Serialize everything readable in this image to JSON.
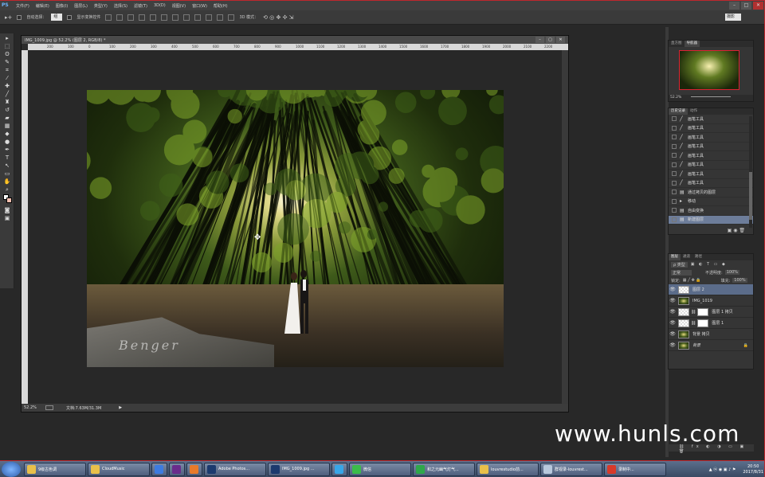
{
  "app": {
    "logo": "PS"
  },
  "menu": [
    "文件(F)",
    "编辑(E)",
    "图像(I)",
    "图层(L)",
    "类型(Y)",
    "选择(S)",
    "滤镜(T)",
    "3D(D)",
    "视图(V)",
    "窗口(W)",
    "帮助(H)"
  ],
  "options": {
    "auto_select_label": "自动选择：",
    "auto_select_value": "组",
    "transform_label": "显示变换控件",
    "mode_3d": "3D 模式：",
    "workspace": "摄影"
  },
  "document": {
    "title": "IMG_1009.jpg @ 52.2% (图层 2, RGB/8) *",
    "ruler_ticks": [
      "200",
      "100",
      "0",
      "100",
      "200",
      "300",
      "400",
      "500",
      "600",
      "700",
      "800",
      "900",
      "1000",
      "1100",
      "1200",
      "1300",
      "1400",
      "1500",
      "1600",
      "1700",
      "1800",
      "1900",
      "2000",
      "2100",
      "2200"
    ],
    "zoom": "52.2%",
    "doc_size": "文档:7.63M/31.3M",
    "signature": "Benger"
  },
  "navigator": {
    "tabs": [
      "直方图",
      "导航器"
    ],
    "zoom": "52.2%"
  },
  "history": {
    "tabs": [
      "历史记录",
      "动作"
    ],
    "items": [
      {
        "icon": "╱",
        "label": "画笔工具"
      },
      {
        "icon": "╱",
        "label": "画笔工具"
      },
      {
        "icon": "╱",
        "label": "画笔工具"
      },
      {
        "icon": "╱",
        "label": "画笔工具"
      },
      {
        "icon": "╱",
        "label": "画笔工具"
      },
      {
        "icon": "╱",
        "label": "画笔工具"
      },
      {
        "icon": "╱",
        "label": "画笔工具"
      },
      {
        "icon": "╱",
        "label": "画笔工具"
      },
      {
        "icon": "▤",
        "label": "通过拷贝的图层"
      },
      {
        "icon": "▸",
        "label": "移动"
      },
      {
        "icon": "▤",
        "label": "自由变换"
      },
      {
        "icon": "▤",
        "label": "新建图层"
      }
    ]
  },
  "layers": {
    "tabs": [
      "图层",
      "通道",
      "路径"
    ],
    "kind": "ρ 类型",
    "blend": "正常",
    "opacity_label": "不透明度:",
    "opacity": "100%",
    "lock_label": "锁定:",
    "fill_label": "填充:",
    "fill": "100%",
    "items": [
      {
        "name": "图层 2",
        "thumb": "checker",
        "mask": false
      },
      {
        "name": "IMG_1019",
        "thumb": "img",
        "mask": false
      },
      {
        "name": "图层 1 拷贝",
        "thumb": "checker",
        "mask": true
      },
      {
        "name": "图层 1",
        "thumb": "checker",
        "mask": true
      },
      {
        "name": "背景 拷贝",
        "thumb": "img",
        "mask": false
      },
      {
        "name": "背景",
        "thumb": "img",
        "mask": false
      }
    ]
  },
  "watermark": "www.hunls.com",
  "taskbar": {
    "items": [
      {
        "label": "9级古色调",
        "color": "#e8c04a"
      },
      {
        "label": "CloudMusic",
        "color": "#e8c04a"
      },
      {
        "label": "",
        "color": "#3d7be0"
      },
      {
        "label": "",
        "color": "#6a2c8c"
      },
      {
        "label": "",
        "color": "#e87a2a"
      },
      {
        "label": "Adobe Photos...",
        "color": "#1c3a6e"
      },
      {
        "label": "IMG_1009.jpg ...",
        "color": "#1c3a6e"
      },
      {
        "label": "",
        "color": "#38a6e8"
      },
      {
        "label": "微信",
        "color": "#3cbc4a"
      },
      {
        "label": "和之元幽气灯气...",
        "color": "#2fa84a"
      },
      {
        "label": "louvrestudio前...",
        "color": "#e8c04a"
      },
      {
        "label": "群视录-louvrest...",
        "color": "#b8c8dc"
      },
      {
        "label": "录制中...",
        "color": "#d83a2a"
      }
    ],
    "time": "20:50",
    "date": "2017/8/31"
  }
}
